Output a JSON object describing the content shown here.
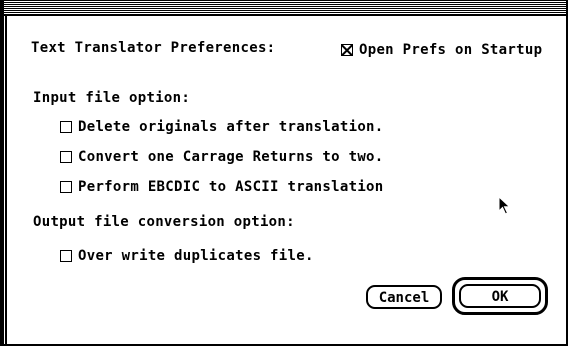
{
  "dialog": {
    "heading": "Text Translator Preferences:",
    "open_prefs_label": "Open Prefs on Startup",
    "open_prefs_checked": true,
    "input_section_label": "Input file option:",
    "input_options": [
      {
        "label": "Delete originals after translation.",
        "checked": false
      },
      {
        "label": "Convert one Carrage Returns to two.",
        "checked": false
      },
      {
        "label": "Perform EBCDIC to ASCII translation",
        "checked": false
      }
    ],
    "output_section_label": "Output file conversion option:",
    "output_options": [
      {
        "label": "Over write duplicates file.",
        "checked": false
      }
    ],
    "cancel_label": "Cancel",
    "ok_label": "OK"
  },
  "icons": {
    "cursor": "arrow-pointer-icon",
    "checkbox_checked": "x-mark"
  }
}
